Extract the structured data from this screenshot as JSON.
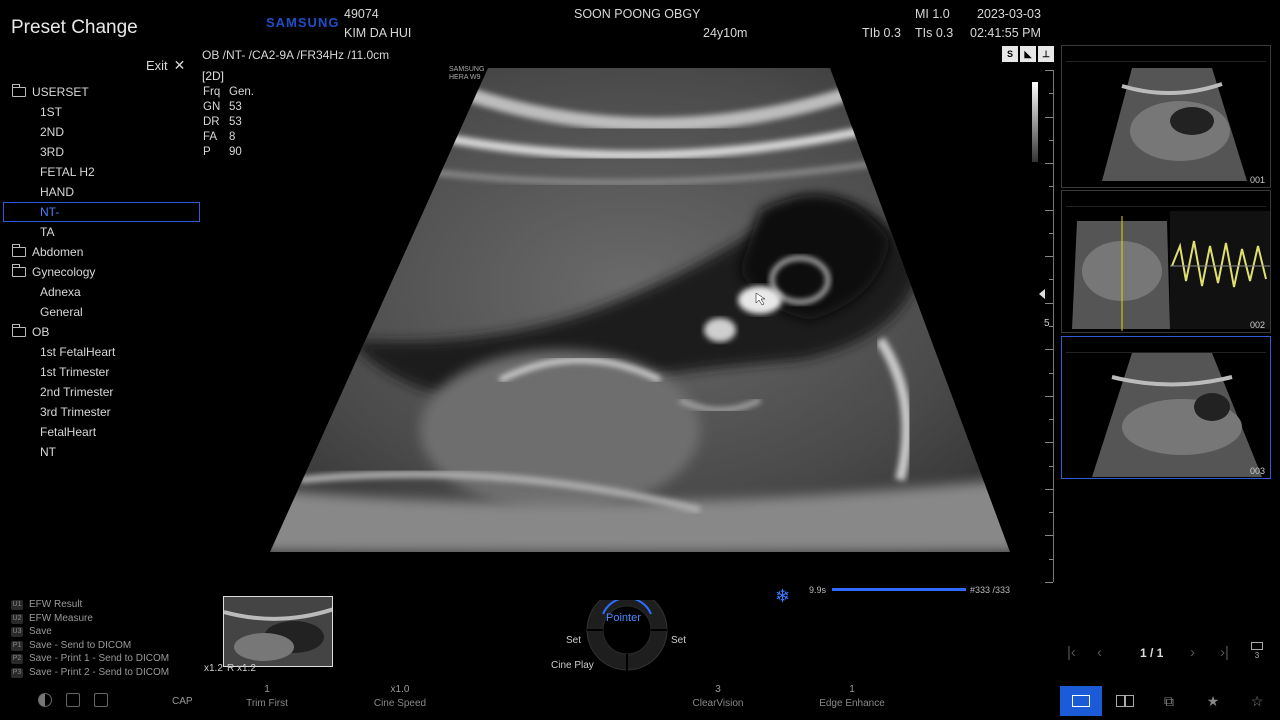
{
  "panel": {
    "title": "Preset Change",
    "exit_label": "Exit",
    "presets": [
      {
        "label": "USERSET",
        "type": "folder"
      },
      {
        "label": "1ST",
        "type": "item"
      },
      {
        "label": "2ND",
        "type": "item"
      },
      {
        "label": "3RD",
        "type": "item"
      },
      {
        "label": "FETAL H2",
        "type": "item"
      },
      {
        "label": "HAND",
        "type": "item"
      },
      {
        "label": "NT-",
        "type": "item",
        "selected": true
      },
      {
        "label": "TA",
        "type": "item"
      },
      {
        "label": "Abdomen",
        "type": "folder"
      },
      {
        "label": "Gynecology",
        "type": "folder"
      },
      {
        "label": "Adnexa",
        "type": "item"
      },
      {
        "label": "General",
        "type": "item"
      },
      {
        "label": "OB",
        "type": "folder"
      },
      {
        "label": "1st FetalHeart",
        "type": "item"
      },
      {
        "label": "1st Trimester",
        "type": "item"
      },
      {
        "label": "2nd Trimester",
        "type": "item"
      },
      {
        "label": "3rd Trimester",
        "type": "item"
      },
      {
        "label": "FetalHeart",
        "type": "item"
      },
      {
        "label": "NT",
        "type": "item"
      }
    ],
    "shortcuts": [
      {
        "key": "U1",
        "label": "EFW Result"
      },
      {
        "key": "U2",
        "label": "EFW Measure"
      },
      {
        "key": "U3",
        "label": "Save"
      },
      {
        "key": "P1",
        "label": "Save - Send to DICOM"
      },
      {
        "key": "P2",
        "label": "Save - Print 1 - Send to DICOM"
      },
      {
        "key": "P3",
        "label": "Save - Print 2 - Send to DICOM"
      }
    ],
    "cap_label": "CAP"
  },
  "header": {
    "brand": "SAMSUNG",
    "patient_id": "49074",
    "patient_name": "KIM DA HUI",
    "hospital": "SOON POONG OBGY",
    "age": "24y10m",
    "mi": "MI  1.0",
    "tib": "TIb 0.3",
    "tis": "TIs 0.3",
    "date": "2023-03-03",
    "time": "02:41:55 PM"
  },
  "image_info": {
    "probe_line": "OB /NT- /CA2-9A /FR34Hz /11.0cm",
    "mode": "[2D]",
    "params": [
      {
        "k": "Frq",
        "v": "Gen."
      },
      {
        "k": "GN",
        "v": "53"
      },
      {
        "k": "DR",
        "v": "53"
      },
      {
        "k": "FA",
        "v": "8"
      },
      {
        "k": "P",
        "v": "90"
      }
    ],
    "small_logo_1": "SAMSUNG",
    "small_logo_2": "HERA W9",
    "focus_number": "5"
  },
  "thumbnails": [
    {
      "num": "001"
    },
    {
      "num": "002"
    },
    {
      "num": "003"
    }
  ],
  "cine": {
    "time": "9.9s",
    "frame": "#333 /333",
    "progress": 1.0
  },
  "controls": {
    "zoom_1": "x1.2",
    "zoom_2": "R x1.2",
    "dial_label": "Pointer",
    "set_left": "Set",
    "set_right": "Set",
    "cine_play": "Cine Play",
    "softkeys": [
      {
        "value": "1",
        "label": "Trim First"
      },
      {
        "value": "x1.0",
        "label": "Cine Speed"
      },
      {
        "value": "3",
        "label": "ClearVision"
      },
      {
        "value": "1",
        "label": "Edge Enhance"
      }
    ]
  },
  "navigation": {
    "page_info": "1 / 1",
    "page_icon_num": "3"
  },
  "colors": {
    "accent": "#1b5bd8",
    "selection": "#4a7dff",
    "brand_blue": "#1f4fc7"
  }
}
